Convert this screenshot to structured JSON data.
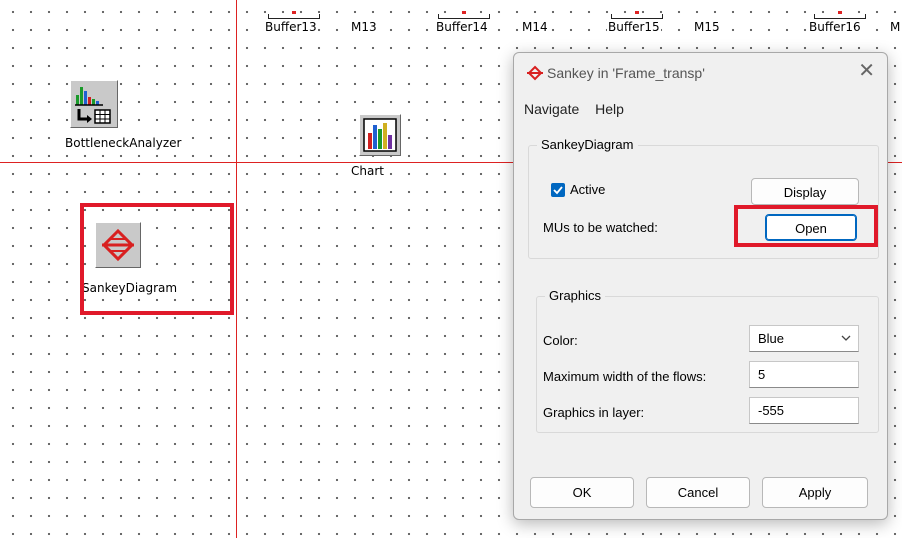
{
  "canvas": {
    "buffers": [
      "Buffer13",
      "Buffer14",
      "Buffer15",
      "Buffer16"
    ],
    "machines": [
      "M13",
      "M14",
      "M15",
      "M"
    ],
    "tools": {
      "bottleneck_analyzer": "BottleneckAnalyzer",
      "chart": "Chart",
      "sankey_diagram": "SankeyDiagram"
    }
  },
  "dialog": {
    "title": "Sankey in 'Frame_transp'",
    "menu": [
      "Navigate",
      "Help"
    ],
    "sankey_group": {
      "title": "SankeyDiagram",
      "active_label": "Active",
      "active_checked": true,
      "display_button": "Display",
      "mus_label": "MUs to be watched:",
      "open_button": "Open"
    },
    "graphics_group": {
      "title": "Graphics",
      "color_label": "Color:",
      "color_value": "Blue",
      "max_width_label": "Maximum width of the flows:",
      "max_width_value": "5",
      "layer_label": "Graphics in layer:",
      "layer_value": "-555"
    },
    "buttons": {
      "ok": "OK",
      "cancel": "Cancel",
      "apply": "Apply"
    }
  },
  "colors": {
    "highlight": "#e0192a",
    "accent": "#0067c0",
    "axis_line": "#dd2222"
  }
}
